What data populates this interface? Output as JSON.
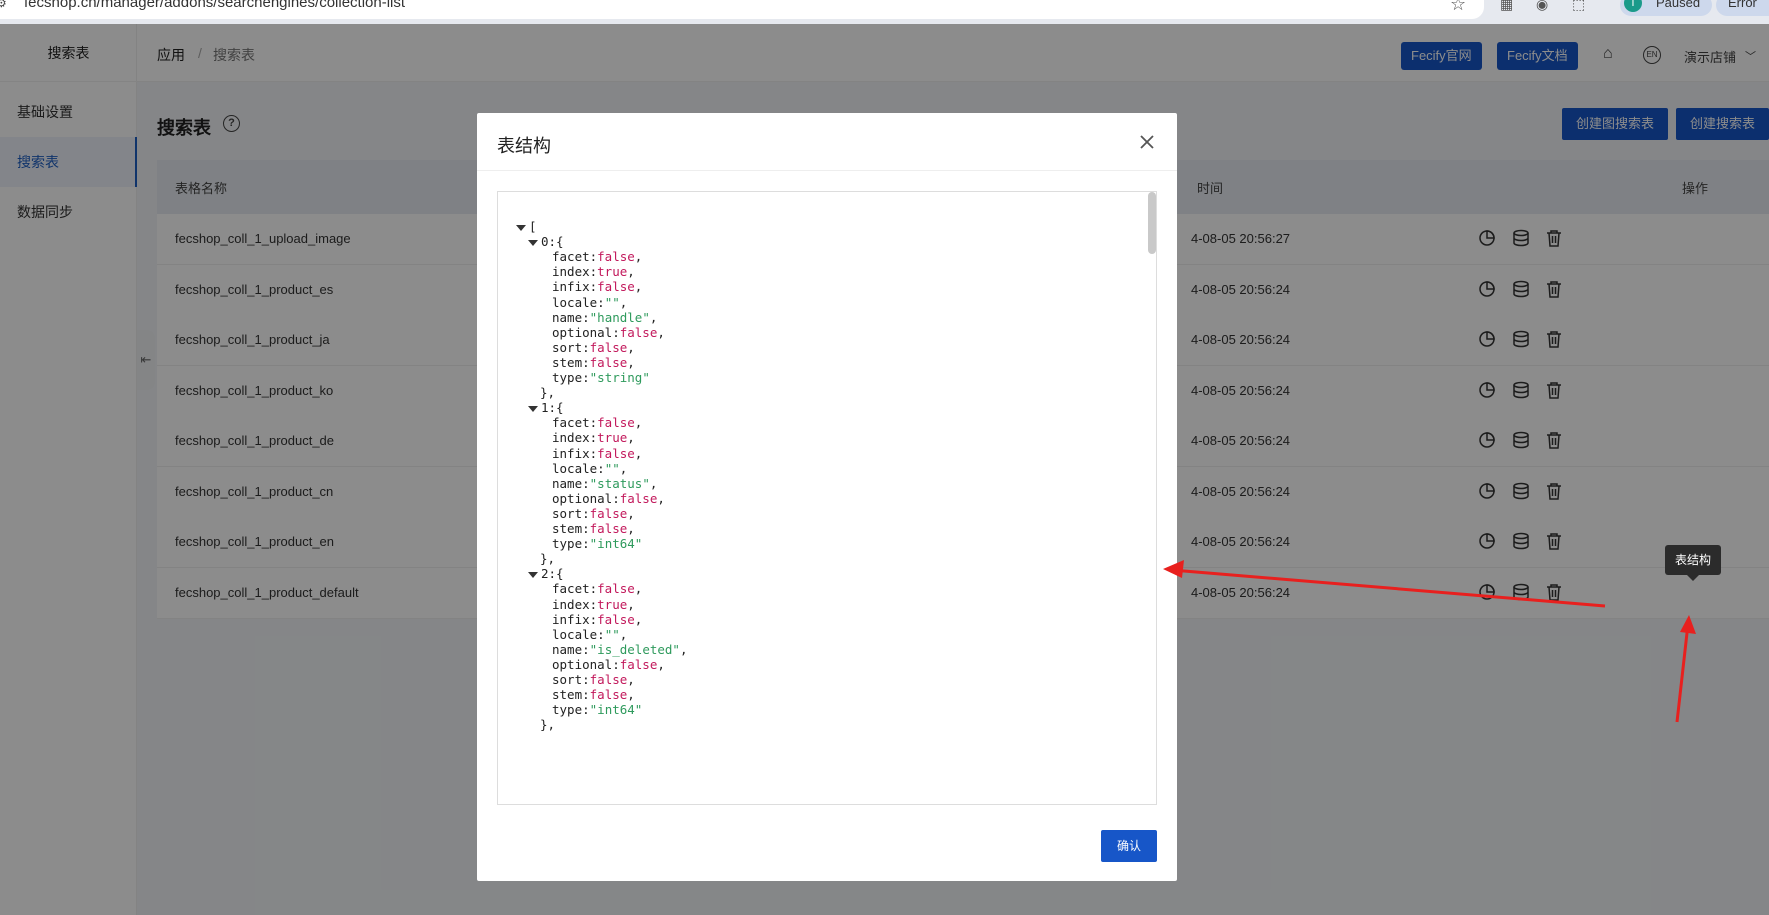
{
  "browser": {
    "url": "fecshop.cn/manager/addons/searchengines/collection-list",
    "profile_initial": "T",
    "profile_status": "Paused",
    "error_label": "Error"
  },
  "sidebar": {
    "title": "搜索表",
    "items": [
      {
        "label": "基础设置"
      },
      {
        "label": "搜索表"
      },
      {
        "label": "数据同步"
      }
    ]
  },
  "header": {
    "breadcrumb_root": "应用",
    "breadcrumb_sep": "/",
    "breadcrumb_current": "搜索表",
    "btn_site": "Fecify官网",
    "btn_docs": "Fecify文档",
    "store": "演示店铺"
  },
  "main": {
    "title": "搜索表",
    "btn_create_image": "创建图搜索表",
    "btn_create": "创建搜索表",
    "columns": {
      "name": "表格名称",
      "time": "时间",
      "ops": "操作"
    },
    "rows": [
      {
        "name": "fecshop_coll_1_upload_image",
        "time": "4-08-05 20:56:27"
      },
      {
        "name": "fecshop_coll_1_product_es",
        "time": "4-08-05 20:56:24"
      },
      {
        "name": "fecshop_coll_1_product_ja",
        "time": "4-08-05 20:56:24"
      },
      {
        "name": "fecshop_coll_1_product_ko",
        "time": "4-08-05 20:56:24"
      },
      {
        "name": "fecshop_coll_1_product_de",
        "time": "4-08-05 20:56:24"
      },
      {
        "name": "fecshop_coll_1_product_cn",
        "time": "4-08-05 20:56:24"
      },
      {
        "name": "fecshop_coll_1_product_en",
        "time": "4-08-05 20:56:24"
      },
      {
        "name": "fecshop_coll_1_product_default",
        "time": "4-08-05 20:56:24"
      }
    ],
    "tooltip": "表结构"
  },
  "modal": {
    "title": "表结构",
    "ok_label": "确认",
    "fields": [
      {
        "index": "0",
        "facet": "false",
        "index_v": "true",
        "infix": "false",
        "locale": "\"\"",
        "name": "\"handle\"",
        "optional": "false",
        "sort": "false",
        "stem": "false",
        "type": "\"string\""
      },
      {
        "index": "1",
        "facet": "false",
        "index_v": "true",
        "infix": "false",
        "locale": "\"\"",
        "name": "\"status\"",
        "optional": "false",
        "sort": "false",
        "stem": "false",
        "type": "\"int64\""
      },
      {
        "index": "2",
        "facet": "false",
        "index_v": "true",
        "infix": "false",
        "locale": "\"\"",
        "name": "\"is_deleted\"",
        "optional": "false",
        "sort": "false",
        "stem": "false",
        "type": "\"int64\""
      }
    ]
  },
  "colors": {
    "accent": "#1756c8",
    "bool": "#c2185b",
    "string": "#2e9a5c",
    "annotation": "#e8201e"
  }
}
